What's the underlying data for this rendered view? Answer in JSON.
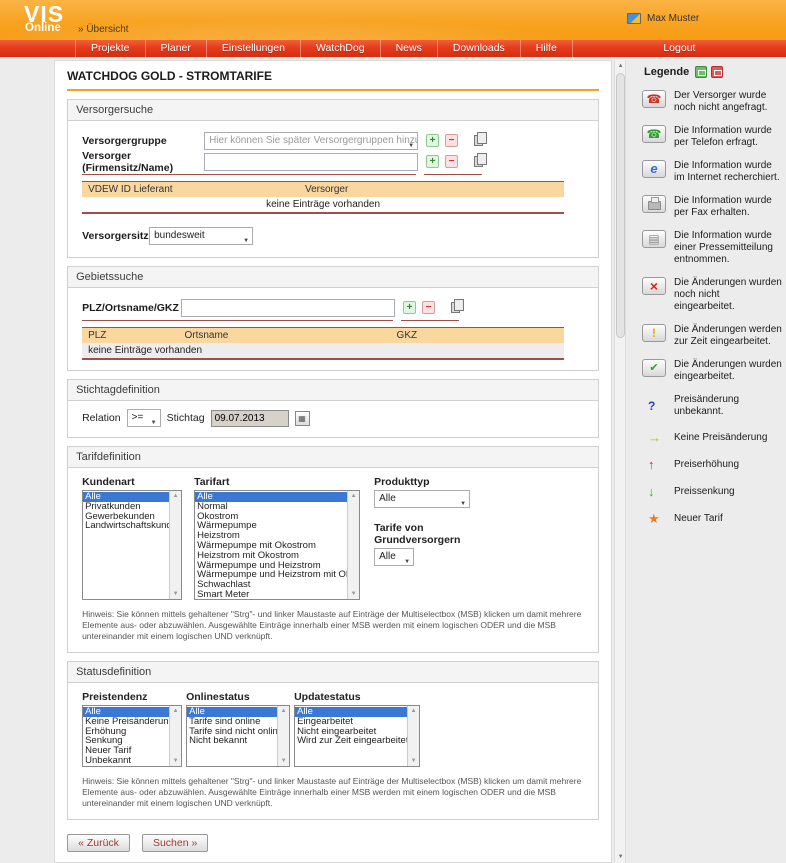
{
  "colors": {
    "brand_orange": "#f79c15",
    "nav_red": "#e63c1d",
    "accent_maroon": "#9e5048",
    "table_header_tan": "#fbd7a0",
    "selection_blue": "#3b77d5"
  },
  "header": {
    "logo_line1": "VIS",
    "logo_line2": "Online",
    "breadcrumb": "» Übersicht",
    "user": "Max Muster"
  },
  "nav": {
    "items": [
      "Projekte",
      "Planer",
      "Einstellungen",
      "WatchDog",
      "News",
      "Downloads",
      "Hilfe"
    ],
    "logout": "Logout"
  },
  "page": {
    "title": "WATCHDOG GOLD - STROMTARIFE"
  },
  "versorgersuche": {
    "title": "Versorgersuche",
    "versorgergruppe_label": "Versorgergruppe",
    "versorgergruppe_placeholder": "Hier können Sie später Versorgergruppen hinzufügen.",
    "versorger_label": "Versorger (Firmensitz/Name)",
    "table": {
      "headers": [
        "VDEW ID Lieferant",
        "Versorger"
      ],
      "empty": "keine Einträge vorhanden"
    },
    "versorgersitz_label": "Versorgersitz",
    "versorgersitz_value": "bundesweit"
  },
  "gebietssuche": {
    "title": "Gebietssuche",
    "plz_label": "PLZ/Ortsname/GKZ",
    "table": {
      "headers": [
        "PLZ",
        "Ortsname",
        "GKZ"
      ],
      "empty": "keine Einträge vorhanden"
    }
  },
  "stichtag": {
    "title": "Stichtagdefinition",
    "relation_label": "Relation",
    "relation_value": ">=",
    "stichtag_label": "Stichtag",
    "stichtag_value": "09.07.2013"
  },
  "tarifdefinition": {
    "title": "Tarifdefinition",
    "kundenart": {
      "label": "Kundenart",
      "options": [
        "Alle",
        "Privatkunden",
        "Gewerbekunden",
        "Landwirtschaftskunden"
      ],
      "selected": "Alle"
    },
    "tarifart": {
      "label": "Tarifart",
      "options": [
        "Alle",
        "Normal",
        "Ökostrom",
        "Wärmepumpe",
        "Heizstrom",
        "Wärmepumpe mit Ökostrom",
        "Heizstrom mit Ökostrom",
        "Wärmepumpe und Heizstrom",
        "Wärmepumpe und Heizstrom mit Ökostrom",
        "Schwachlast",
        "Smart Meter"
      ],
      "selected": "Alle"
    },
    "produkttyp": {
      "label": "Produkttyp",
      "value": "Alle"
    },
    "grundversorger": {
      "label_line1": "Tarife von",
      "label_line2": "Grundversorgern",
      "value": "Alle"
    }
  },
  "statusdefinition": {
    "title": "Statusdefinition",
    "preistendenz": {
      "label": "Preistendenz",
      "options": [
        "Alle",
        "Keine Preisänderung",
        "Erhöhung",
        "Senkung",
        "Neuer Tarif",
        "Unbekannt"
      ],
      "selected": "Alle"
    },
    "onlinestatus": {
      "label": "Onlinestatus",
      "options": [
        "Alle",
        "Tarife sind online",
        "Tarife sind nicht online",
        "Nicht bekannt"
      ],
      "selected": "Alle"
    },
    "updatestatus": {
      "label": "Updatestatus",
      "options": [
        "Alle",
        "Eingearbeitet",
        "Nicht eingearbeitet",
        "Wird zur Zeit eingearbeitet"
      ],
      "selected": "Alle"
    }
  },
  "hinweis": "Hinweis: Sie können mittels gehaltener \"Strg\"- und linker Maustaste auf Einträge der Multiselectbox (MSB) klicken um damit mehrere Elemente aus- oder abzuwählen. Ausgewählte Einträge innerhalb einer MSB werden mit einem logischen ODER und die MSB untereinander mit einem logischen UND verknüpft.",
  "actions": {
    "back": "« Zurück",
    "search": "Suchen »"
  },
  "legende": {
    "title": "Legende",
    "items": [
      {
        "icon": "phone-red",
        "text": "Der Versorger wurde noch nicht angefragt."
      },
      {
        "icon": "phone-green",
        "text": "Die Information wurde per Telefon erfragt."
      },
      {
        "icon": "internet-explorer",
        "text": "Die Information wurde im Internet recherchiert."
      },
      {
        "icon": "fax",
        "text": "Die Information wurde per Fax erhalten."
      },
      {
        "icon": "pressemitteilung",
        "text": "Die Information wurde einer Pressemitteilung entnommen."
      },
      {
        "icon": "red-x",
        "text": "Die Änderungen wurden noch nicht eingearbeitet."
      },
      {
        "icon": "yellow-exclamation",
        "text": "Die Änderungen werden zur Zeit eingearbeitet."
      },
      {
        "icon": "green-check",
        "text": "Die Änderungen wurden eingearbeitet."
      },
      {
        "icon": "question-mark",
        "text": "Preisänderung unbekannt."
      },
      {
        "icon": "arrow-right",
        "text": "Keine Preisänderung"
      },
      {
        "icon": "arrow-up",
        "text": "Preiserhöhung"
      },
      {
        "icon": "arrow-down",
        "text": "Preissenkung"
      },
      {
        "icon": "star",
        "text": "Neuer Tarif"
      }
    ]
  }
}
